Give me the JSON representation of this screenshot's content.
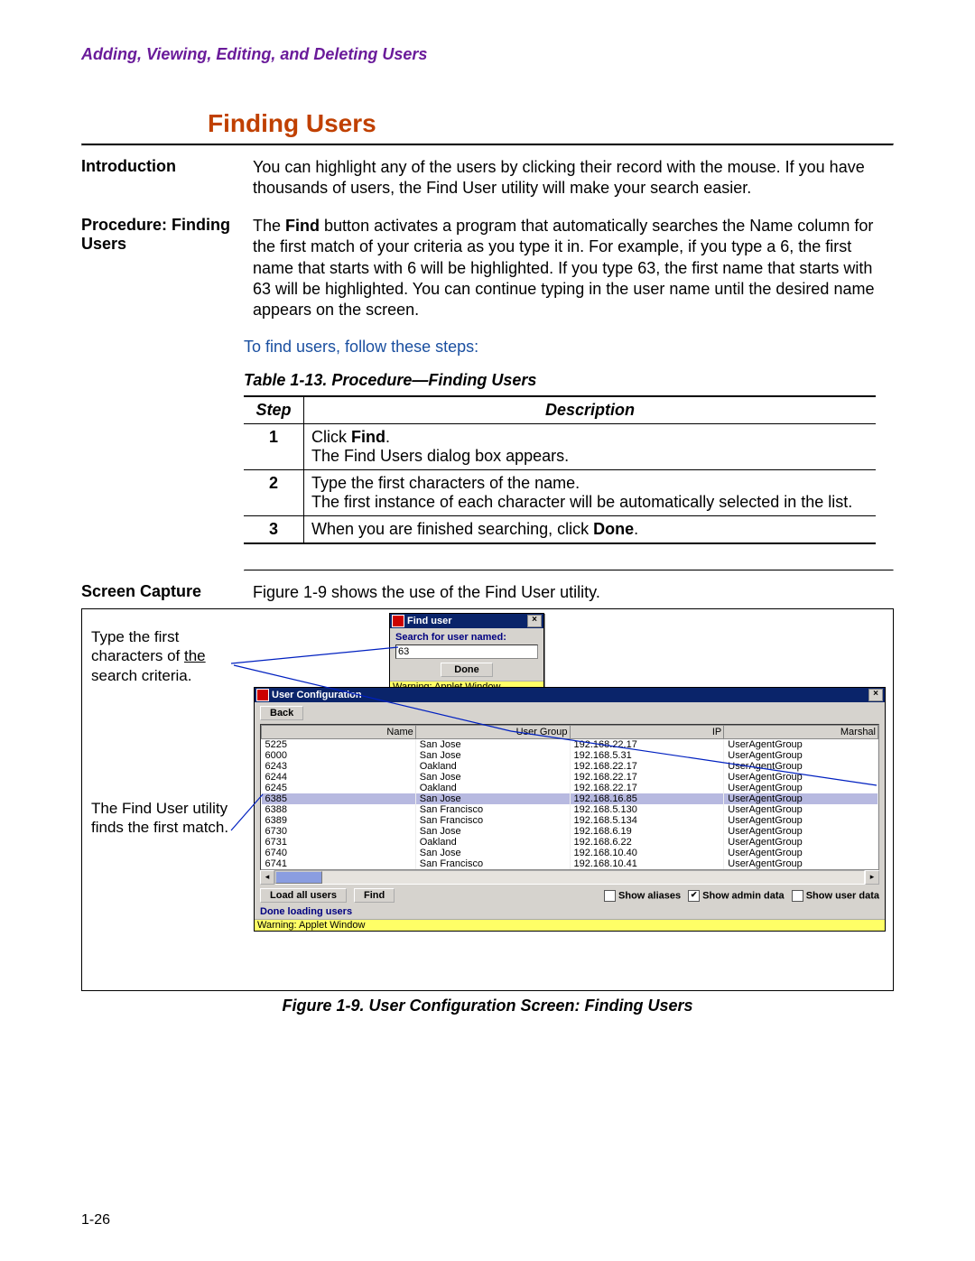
{
  "running_header": "Adding, Viewing, Editing, and Deleting Users",
  "section_title": "Finding Users",
  "intro_label": "Introduction",
  "intro_text": "You can highlight any of the users by clicking their record with the mouse. If you have thousands of users, the Find User utility will make your search easier.",
  "proc_label": "Procedure: Finding Users",
  "proc_text_prefix": "The ",
  "proc_text_bold": "Find",
  "proc_text_suffix": " button activates a program that automatically searches the Name column for the first match of your criteria as you type it in. For example, if you type a 6, the first name that starts with 6 will be highlighted. If you type 63, the first name that starts with 63 will be highlighted. You can continue typing in the user name until the desired name appears on the screen.",
  "instruction": "To find users, follow these steps:",
  "table_caption": "Table 1-13. Procedure—Finding Users",
  "table_headers": {
    "step": "Step",
    "desc": "Description"
  },
  "steps": [
    {
      "n": "1",
      "d1_a": "Click ",
      "d1_b": "Find",
      "d1_c": ".",
      "d2": "The Find Users dialog box appears."
    },
    {
      "n": "2",
      "d1": "Type the first characters of the name.",
      "d2": "The first instance of each character will be automatically selected in the list."
    },
    {
      "n": "3",
      "d1_a": "When you are finished searching, click ",
      "d1_b": "Done",
      "d1_c": "."
    }
  ],
  "screen_label": "Screen Capture",
  "screen_intro": "Figure 1-9 shows the use of the Find User utility.",
  "annot1": "Type the first characters of the search criteria.",
  "annot2": "The Find User utility finds the first match.",
  "find_dialog": {
    "title": "Find user",
    "label": "Search for user named:",
    "value": "63",
    "done": "Done",
    "warn": "Warning: Applet Window"
  },
  "cfg": {
    "title": "User Configuration",
    "back": "Back",
    "cols": {
      "name": "Name",
      "group": "User Group",
      "ip": "IP",
      "marshal": "Marshal"
    },
    "rows": [
      {
        "name": "5225",
        "group": "San Jose",
        "ip": "192.168.22.17",
        "marshal": "UserAgentGroup"
      },
      {
        "name": "6000",
        "group": "San Jose",
        "ip": "192.168.5.31",
        "marshal": "UserAgentGroup"
      },
      {
        "name": "6243",
        "group": "Oakland",
        "ip": "192.168.22.17",
        "marshal": "UserAgentGroup"
      },
      {
        "name": "6244",
        "group": "San Jose",
        "ip": "192.168.22.17",
        "marshal": "UserAgentGroup"
      },
      {
        "name": "6245",
        "group": "Oakland",
        "ip": "192.168.22.17",
        "marshal": "UserAgentGroup"
      },
      {
        "name": "6385",
        "group": "San Jose",
        "ip": "192.168.16.85",
        "marshal": "UserAgentGroup",
        "hl": true
      },
      {
        "name": "6388",
        "group": "San Francisco",
        "ip": "192.168.5.130",
        "marshal": "UserAgentGroup"
      },
      {
        "name": "6389",
        "group": "San Francisco",
        "ip": "192.168.5.134",
        "marshal": "UserAgentGroup"
      },
      {
        "name": "6730",
        "group": "San Jose",
        "ip": "192.168.6.19",
        "marshal": "UserAgentGroup"
      },
      {
        "name": "6731",
        "group": "Oakland",
        "ip": "192.168.6.22",
        "marshal": "UserAgentGroup"
      },
      {
        "name": "6740",
        "group": "San Jose",
        "ip": "192.168.10.40",
        "marshal": "UserAgentGroup"
      },
      {
        "name": "6741",
        "group": "San Francisco",
        "ip": "192.168.10.41",
        "marshal": "UserAgentGroup"
      }
    ],
    "load_all": "Load all users",
    "find": "Find",
    "chk1": "Show aliases",
    "chk2": "Show admin data",
    "chk3": "Show user data",
    "status": "Done loading users",
    "warn": "Warning: Applet Window"
  },
  "fig_caption": "Figure 1-9. User Configuration Screen: Finding Users",
  "page_num": "1-26"
}
